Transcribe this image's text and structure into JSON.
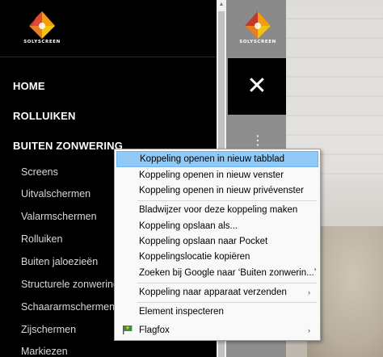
{
  "brand": {
    "logo_text": "SOLYSCREEN"
  },
  "nav": {
    "main": [
      "HOME",
      "ROLLUIKEN",
      "BUITEN ZONWERING"
    ],
    "sub": [
      "Screens",
      "Uitvalschermen",
      "Valarmschermen",
      "Rolluiken",
      "Buiten jaloezieën",
      "Structurele zonwering",
      "Schaararmschermen",
      "Zijschermen",
      "Markiezen"
    ]
  },
  "page": {
    "close_glyph": "✕",
    "more_glyph": "⋮"
  },
  "context_menu": {
    "items": [
      "Koppeling openen in nieuw tabblad",
      "Koppeling openen in nieuw venster",
      "Koppeling openen in nieuw privévenster",
      "Bladwijzer voor deze koppeling maken",
      "Koppeling opslaan als...",
      "Koppeling opslaan naar Pocket",
      "Koppelingslocatie kopiëren",
      "Zoeken bij Google naar ‘Buiten zonwerin...’",
      "Koppeling naar apparaat verzenden",
      "Element inspecteren",
      "Flagfox"
    ],
    "submenu_arrow": "›"
  },
  "colors": {
    "highlight": "#91c9f7",
    "menu_bg": "#f9f9f9",
    "nav_bg": "#000000"
  }
}
